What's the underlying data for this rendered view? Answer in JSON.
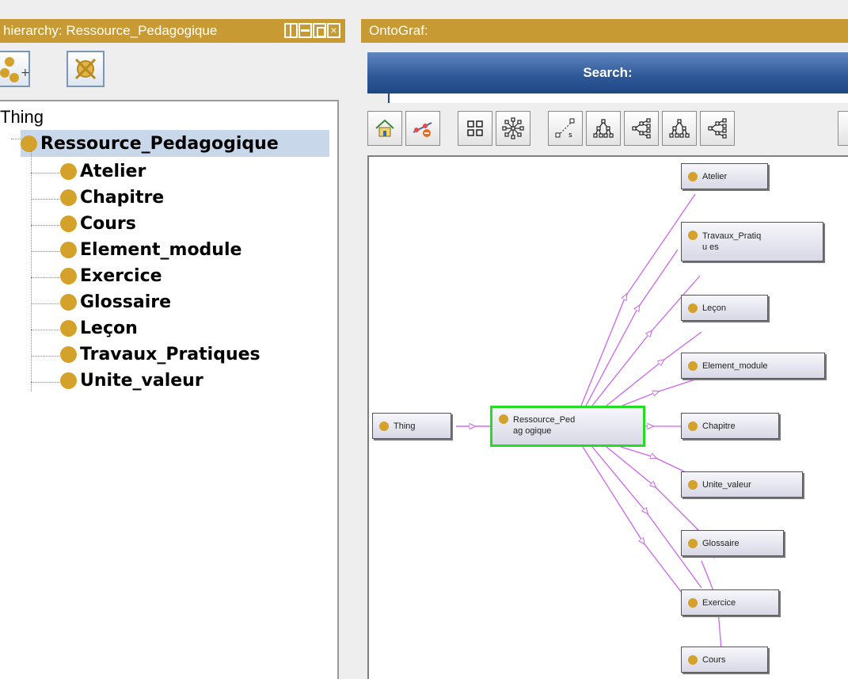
{
  "left_panel": {
    "title": "hierarchy: Ressource_Pedagogique",
    "toolbar": {
      "add_subclass_icon": "add-subclass-icon",
      "delete_class_icon": "delete-class-icon"
    },
    "tree": {
      "root": "Thing",
      "selected": "Ressource_Pedagogique",
      "children": [
        "Atelier",
        "Chapitre",
        "Cours",
        "Element_module",
        "Exercice",
        "Glossaire",
        "Leçon",
        "Travaux_Pratiques",
        "Unite_valeur"
      ]
    }
  },
  "right_panel": {
    "title": "OntoGraf:",
    "search_label": "Search:",
    "toolbar_icons": [
      "home-icon",
      "remove-node-icon",
      "grid-layout-icon",
      "radial-layout-icon",
      "spring-layout-icon",
      "tree-layout-vertical-icon",
      "tree-layout-horizontal-icon",
      "tree-layout-vertical-alt-icon",
      "tree-layout-horizontal-alt-icon"
    ],
    "graph": {
      "thing": "Thing",
      "center": "Ressource_Pedagogique",
      "center_display": "Ressource_Pedag ogique",
      "nodes": [
        "Atelier",
        "Travaux_Pratiques",
        "Leçon",
        "Element_module",
        "Chapitre",
        "Unite_valeur",
        "Glossaire",
        "Exercice",
        "Cours"
      ],
      "travaux_display": "Travaux_Pratiqu es"
    }
  },
  "colors": {
    "title_bar": "#c89a33",
    "class_dot": "#d4a12a",
    "selection": "#c8d7ea",
    "edge": "#cc66ee",
    "selected_border": "#22dd22"
  }
}
